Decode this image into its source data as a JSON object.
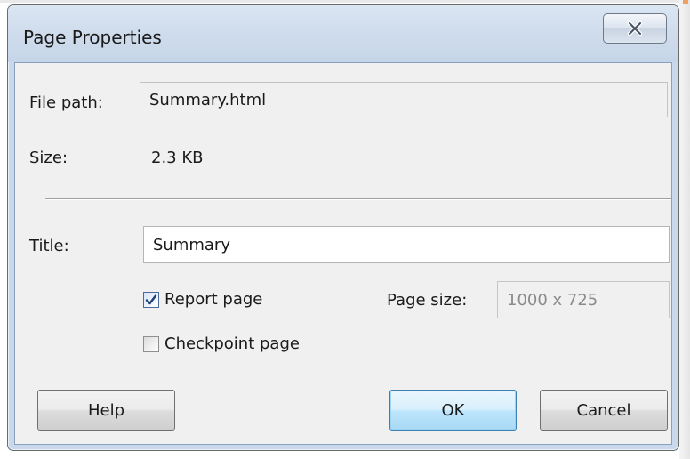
{
  "window": {
    "title": "Page Properties"
  },
  "form": {
    "file_path_label": "File path:",
    "file_path_value": "Summary.html",
    "size_label": "Size:",
    "size_value": "2.3 KB",
    "title_label": "Title:",
    "title_value": "Summary",
    "report_page_label": "Report page",
    "report_page_checked": true,
    "checkpoint_page_label": "Checkpoint page",
    "checkpoint_page_checked": false,
    "page_size_label": "Page size:",
    "page_size_value": "1000 x 725"
  },
  "buttons": {
    "help": "Help",
    "ok": "OK",
    "cancel": "Cancel"
  },
  "icons": {
    "close": "close-icon",
    "check": "check-icon"
  },
  "colors": {
    "frame": "#c9d8ea",
    "client_bg": "#f0f0f0",
    "default_button_border": "#3c7fb1",
    "checkbox_check": "#1f3f77"
  }
}
